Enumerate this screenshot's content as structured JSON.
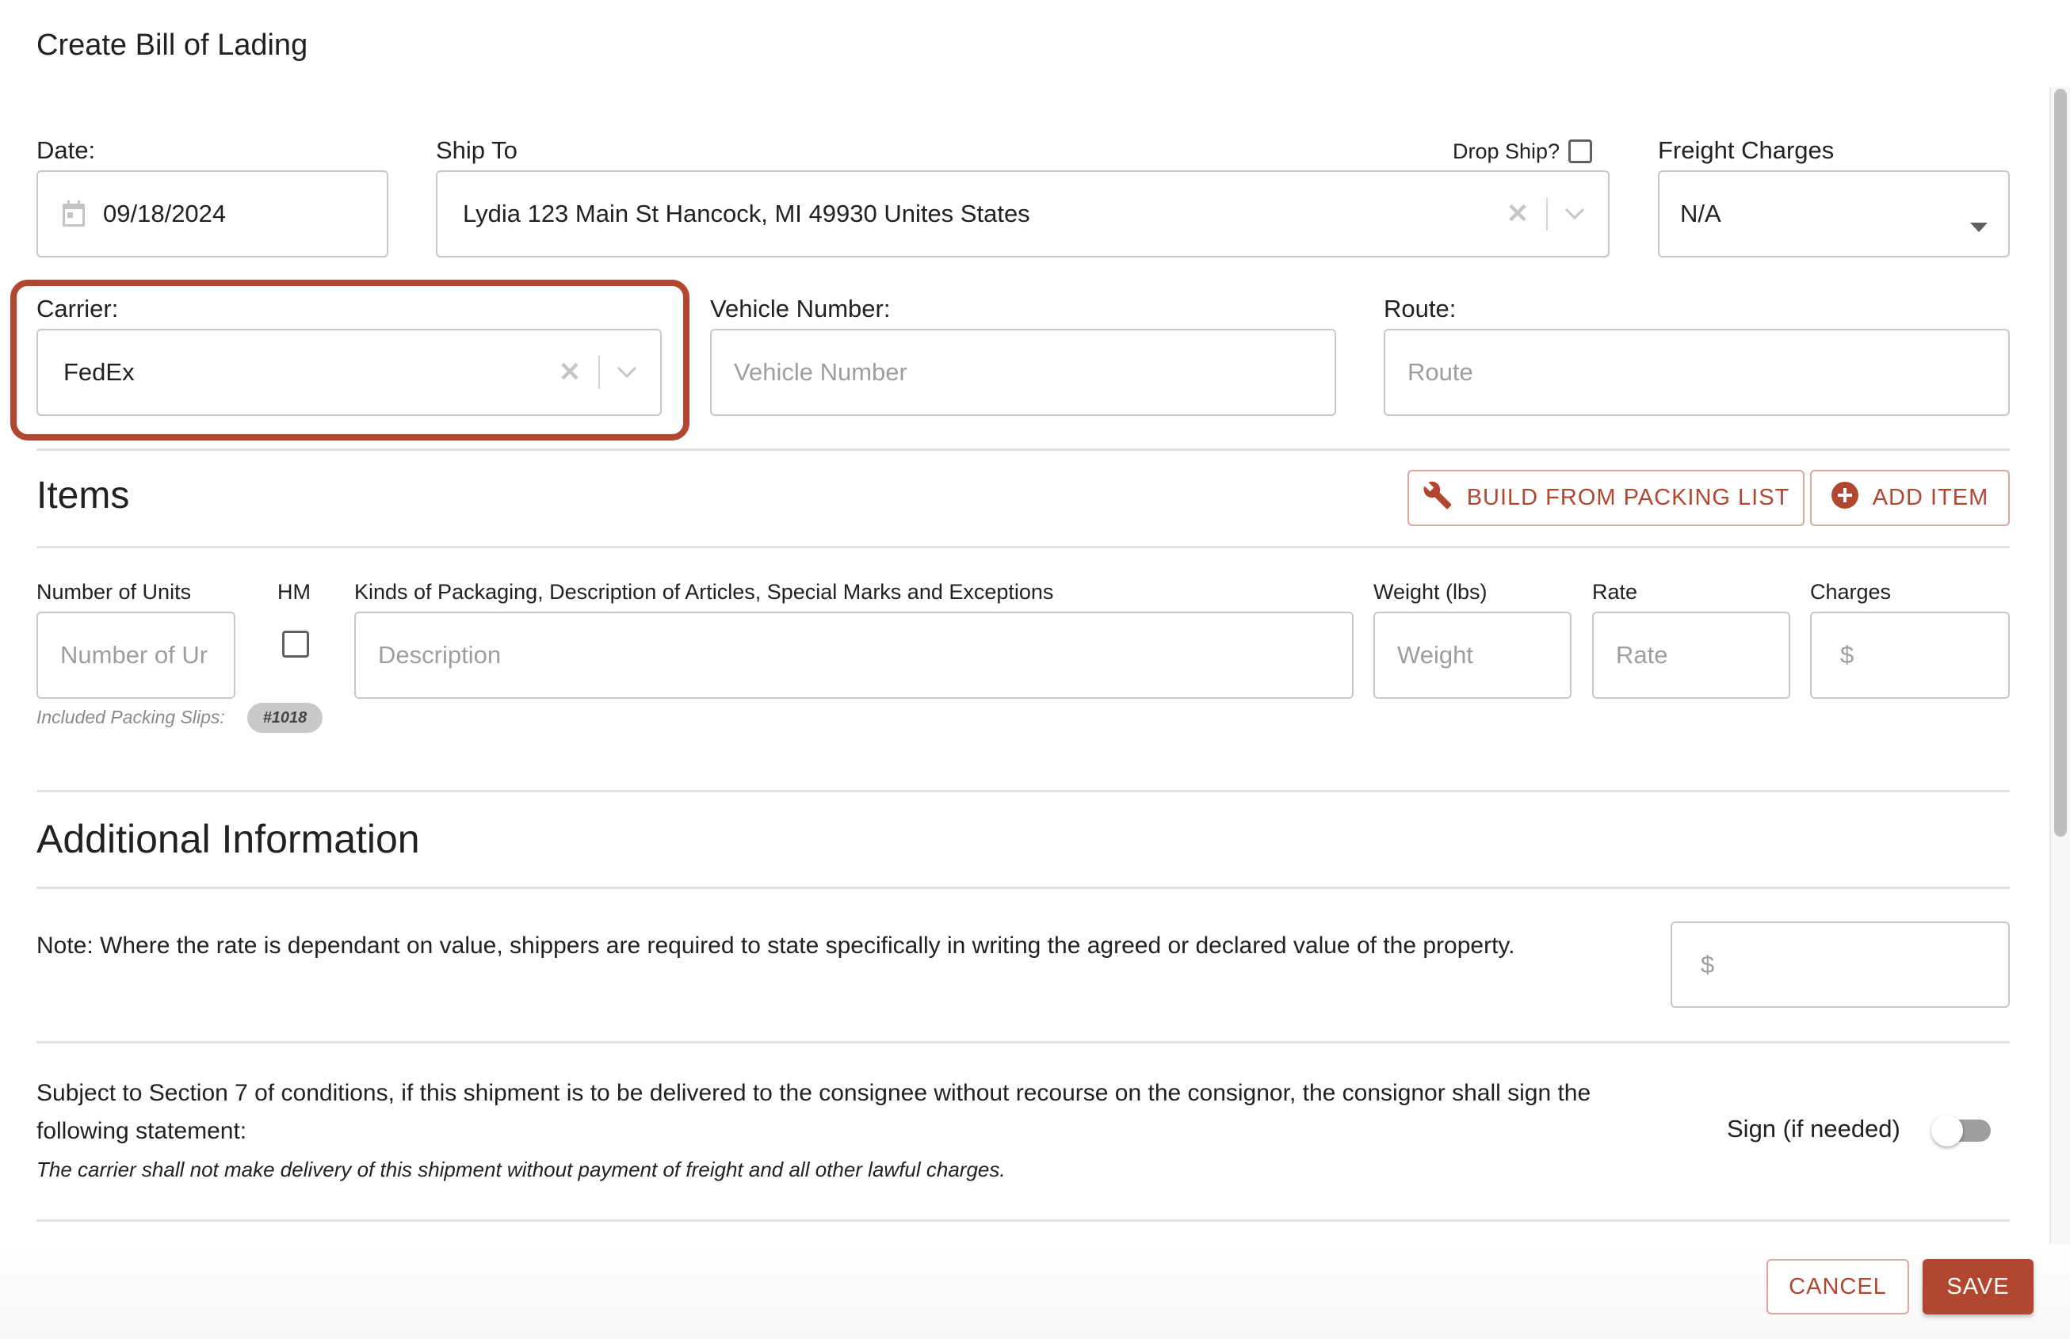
{
  "dialog": {
    "title": "Create Bill of Lading"
  },
  "form": {
    "date": {
      "label": "Date:",
      "value": "09/18/2024",
      "icon": "calendar-icon"
    },
    "ship_to": {
      "label": "Ship To",
      "value": "Lydia 123 Main St Hancock, MI 49930 Unites States"
    },
    "drop_ship": {
      "label": "Drop Ship?",
      "checked": false
    },
    "freight_charges": {
      "label": "Freight Charges",
      "value": "N/A"
    },
    "carrier": {
      "label": "Carrier:",
      "value": "FedEx",
      "highlighted": true
    },
    "vehicle_number": {
      "label": "Vehicle Number:",
      "placeholder": "Vehicle Number",
      "value": ""
    },
    "route": {
      "label": "Route:",
      "placeholder": "Route",
      "value": ""
    }
  },
  "items": {
    "heading": "Items",
    "build_button": "BUILD FROM PACKING LIST",
    "add_button": "ADD ITEM",
    "columns": {
      "units": "Number of Units",
      "hm": "HM",
      "description": "Kinds of Packaging, Description of Articles, Special Marks and Exceptions",
      "weight": "Weight (lbs)",
      "rate": "Rate",
      "charges": "Charges"
    },
    "row": {
      "units_placeholder": "Number of Units",
      "units_visible": "Number of Ur",
      "hm_checked": false,
      "description_placeholder": "Description",
      "weight_placeholder": "Weight",
      "rate_placeholder": "Rate",
      "charges_prefix": "$"
    },
    "packing_slips_label": "Included Packing Slips:",
    "packing_slips": [
      "#1018"
    ]
  },
  "additional": {
    "heading": "Additional Information",
    "note": "Note: Where the rate is dependant on value, shippers are required to state specifically in writing the agreed or declared value of the property.",
    "declared_value_prefix": "$",
    "section7": "Subject to Section 7 of conditions, if this shipment is to be delivered to the consignee without recourse on the consignor, the consignor shall sign the following statement:",
    "statement": "The carrier shall not make delivery of this shipment without payment of freight and all other lawful charges.",
    "sign_label": "Sign (if needed)",
    "sign_enabled": false
  },
  "actions": {
    "cancel": "CANCEL",
    "save": "SAVE"
  },
  "colors": {
    "accent": "#b24731",
    "border": "#c8c8c8",
    "placeholder": "#9e9e9e"
  }
}
